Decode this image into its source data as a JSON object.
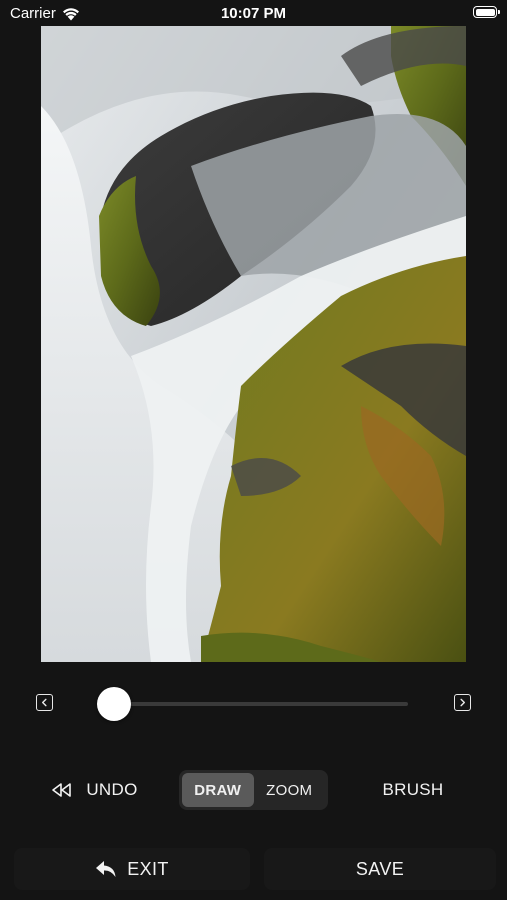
{
  "status_bar": {
    "carrier": "Carrier",
    "time": "10:07 PM"
  },
  "photo": {
    "subject": "waterfall-over-mossy-rocks"
  },
  "slider": {
    "value": 0.0
  },
  "toolbar": {
    "undo_label": "UNDO",
    "modes": [
      "DRAW",
      "ZOOM"
    ],
    "active_mode": "DRAW",
    "brush_label": "BRUSH"
  },
  "bottom_bar": {
    "exit_label": "EXIT",
    "save_label": "SAVE"
  },
  "colors": {
    "background": "#141414",
    "segment_active": "#5a5a5a",
    "moss": "#6f7a1f"
  }
}
